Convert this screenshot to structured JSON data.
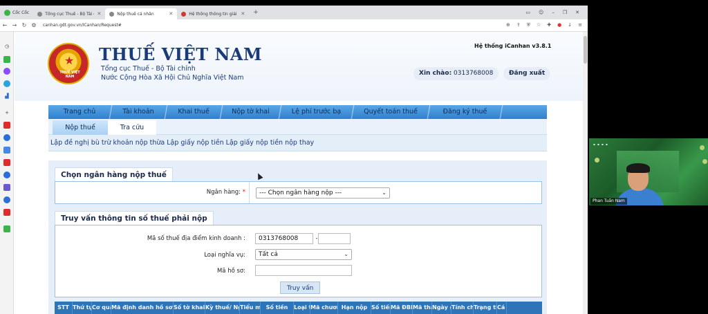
{
  "browser": {
    "brand": "Cốc Cốc",
    "tabs": [
      {
        "title": "Tổng cục Thuế - Bộ Tài chính",
        "active": false
      },
      {
        "title": "Nộp thuế cá nhân",
        "active": true
      },
      {
        "title": "Hệ thống thông tin giải quyết thủ",
        "active": false
      }
    ],
    "url": "canhan.gdt.gov.vn/ICanhan/Request#"
  },
  "header": {
    "emblem_text": "THUẾ VIỆT NAM",
    "title": "THUẾ VIỆT NAM",
    "subtitle1": "Tổng cục Thuế - Bộ Tài chính",
    "subtitle2": "Nước Cộng Hòa Xã Hội Chủ Nghĩa Việt Nam",
    "system_name": "Hệ thống iCanhan v3.8.1",
    "greeting_label": "Xin chào:",
    "greeting_user": "0313768008",
    "logout": "Đăng xuất"
  },
  "main_nav": [
    "Trang chủ",
    "Tài khoản",
    "Khai thuế",
    "Nộp tờ khai",
    "Lệ phí trước bạ",
    "Quyết toán thuế",
    "Đăng ký thuế"
  ],
  "sub_nav": [
    "Nộp thuế",
    "Tra cứu"
  ],
  "links_text": "Lập đề nghị bù trừ khoản nộp thừa Lập giấy nộp tiền Lập giấy nộp tiền nộp thay",
  "bank_section": {
    "title": "Chọn ngân hàng nộp thuế",
    "label": "Ngân hàng:",
    "required_mark": "*",
    "selected": "--- Chọn ngân hàng nộp ---"
  },
  "query_section": {
    "title": "Truy vấn thông tin số thuế phải nộp",
    "tax_code_label": "Mã số thuế địa điểm kinh doanh :",
    "tax_code_value": "0313768008",
    "tax_code_sep": "-",
    "tax_code_suffix": "",
    "obligation_label": "Loại nghĩa vụ:",
    "obligation_value": "Tất cả",
    "profile_label": "Mã hồ sơ:",
    "profile_value": "",
    "query_button": "Truy vấn"
  },
  "table_headers": [
    "STT",
    "Thứ tự",
    "Cơ quan",
    "Mã định danh hồ sơ (ID)",
    "Số tờ khai/Số",
    "Kỳ thuế/ Ngày",
    "Tiểu mục",
    "Số tiền",
    "Loại tiền",
    "Mã chương",
    "Hạn nộp",
    "Số tiền",
    "Mã ĐBHC",
    "Mã tham",
    "Ngày gia",
    "Tính chất",
    "Trạng thái",
    "Cá kh"
  ],
  "webcam": {
    "name": "Phan Tuấn Nam"
  }
}
